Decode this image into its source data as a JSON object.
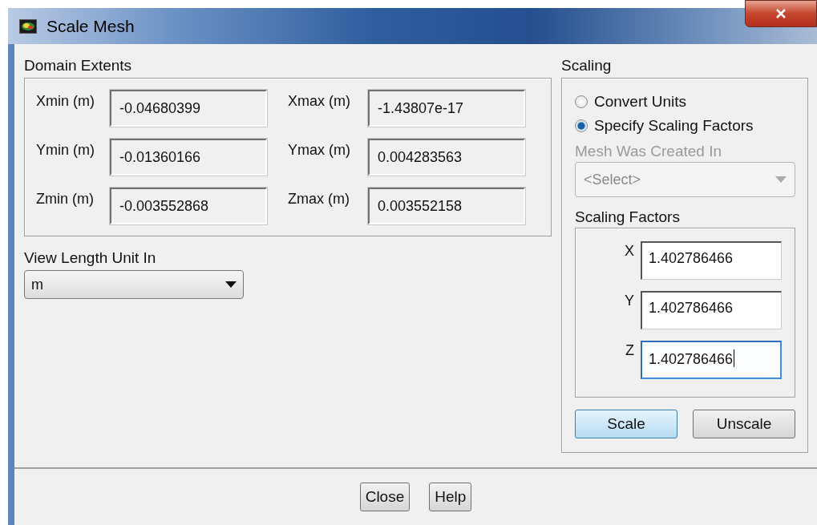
{
  "window": {
    "title": "Scale Mesh"
  },
  "domain_extents": {
    "label": "Domain Extents",
    "fields": [
      {
        "label": "Xmin (m)",
        "value": "-0.04680399"
      },
      {
        "label": "Xmax (m)",
        "value": "-1.43807e-17"
      },
      {
        "label": "Ymin (m)",
        "value": "-0.01360166"
      },
      {
        "label": "Ymax (m)",
        "value": "0.004283563"
      },
      {
        "label": "Zmin (m)",
        "value": "-0.003552868"
      },
      {
        "label": "Zmax (m)",
        "value": "0.003552158"
      }
    ]
  },
  "view_length_unit": {
    "label": "View Length Unit In",
    "value": "m"
  },
  "scaling": {
    "label": "Scaling",
    "options": [
      {
        "label": "Convert Units",
        "selected": false
      },
      {
        "label": "Specify Scaling Factors",
        "selected": true
      }
    ],
    "mesh_created_in": {
      "label": "Mesh Was Created In",
      "value": "<Select>",
      "disabled": true
    },
    "factors": {
      "label": "Scaling Factors",
      "fields": [
        {
          "label": "X",
          "value": "1.402786466",
          "focused": false
        },
        {
          "label": "Y",
          "value": "1.402786466",
          "focused": false
        },
        {
          "label": "Z",
          "value": "1.402786466",
          "focused": true
        }
      ]
    },
    "buttons": [
      {
        "label": "Scale",
        "default": true
      },
      {
        "label": "Unscale",
        "default": false
      }
    ]
  },
  "footer_buttons": [
    "Close",
    "Help"
  ]
}
